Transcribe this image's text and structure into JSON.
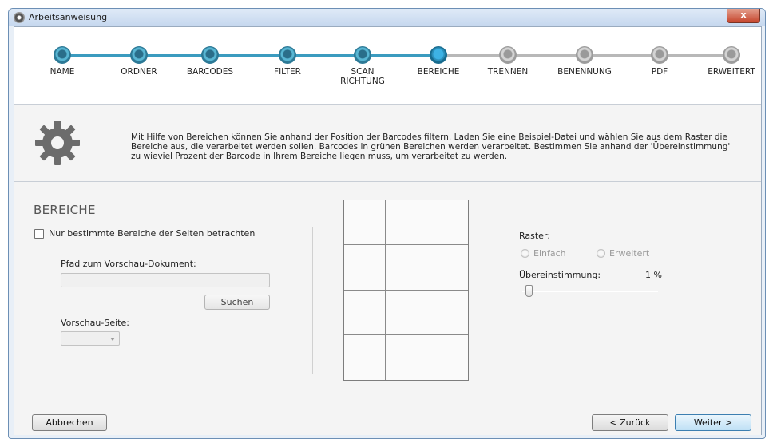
{
  "window": {
    "title": "Arbeitsanweisung",
    "close_label": "x"
  },
  "colors": {
    "step_active": "#3b9bbf",
    "step_inactive": "#b8b8b8",
    "primary_button": "#bfe0f5"
  },
  "steps": [
    {
      "label": "NAME",
      "state": "done"
    },
    {
      "label": "ORDNER",
      "state": "done"
    },
    {
      "label": "BARCODES",
      "state": "done"
    },
    {
      "label": "FILTER",
      "state": "done"
    },
    {
      "label": "SCAN\nRICHTUNG",
      "state": "done"
    },
    {
      "label": "BEREICHE",
      "state": "current"
    },
    {
      "label": "TRENNEN",
      "state": "todo"
    },
    {
      "label": "BENENNUNG",
      "state": "todo"
    },
    {
      "label": "PDF",
      "state": "todo"
    },
    {
      "label": "ERWEITERT",
      "state": "todo"
    }
  ],
  "info": {
    "icon": "gear-icon",
    "text": "Mit Hilfe von Bereichen können Sie anhand der Position der Barcodes filtern. Laden Sie eine Beispiel-Datei und wählen Sie aus dem Raster die Bereiche aus, die verarbeitet werden sollen. Barcodes in grünen Bereichen werden verarbeitet. Bestimmen Sie anhand der 'Übereinstimmung' zu wieviel Prozent der Barcode in Ihrem Bereiche liegen muss, um verarbeitet zu werden."
  },
  "bereiche": {
    "title": "BEREICHE",
    "checkbox_label": "Nur bestimmte Bereiche der Seiten betrachten",
    "checkbox_checked": false,
    "pfad_label": "Pfad zum Vorschau-Dokument:",
    "pfad_value": "",
    "suchen_label": "Suchen",
    "seite_label": "Vorschau-Seite:",
    "seite_value": ""
  },
  "grid": {
    "rows": 4,
    "cols": 3
  },
  "raster": {
    "label": "Raster:",
    "options": [
      "Einfach",
      "Erweitert"
    ],
    "ue_label": "Übereinstimmung:",
    "ue_value": "1 %",
    "ue_percent": 1
  },
  "footer": {
    "cancel_label": "Abbrechen",
    "back_label": "< Zurück",
    "next_label": "Weiter >"
  }
}
